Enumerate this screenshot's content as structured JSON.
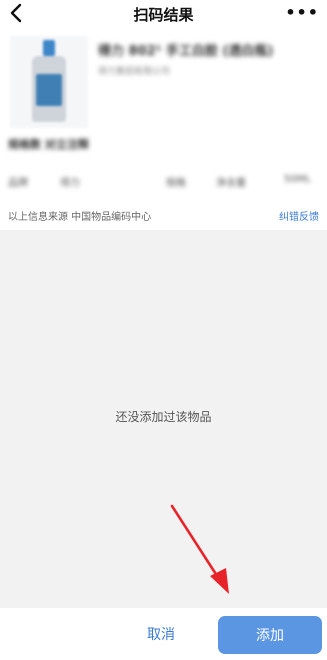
{
  "header": {
    "title": "扫码结果",
    "back_icon": "chevron-left-icon",
    "more_label": "•••"
  },
  "product": {
    "name": "得力 802¹ 手工白胶 (透白瓶)",
    "brand": "得力集团有限公司",
    "tag": "规格数 对立注释",
    "fields": [
      "品牌",
      "得力",
      "规格",
      "净含量",
      "50ML"
    ],
    "source_text": "以上信息来源 中国物品编码中心",
    "feedback_label": "纠错反馈"
  },
  "empty_state": {
    "message": "还没添加过该物品"
  },
  "actions": {
    "cancel_label": "取消",
    "add_label": "添加"
  },
  "colors": {
    "accent": "#3a7bd5",
    "add_button": "#5b96e3",
    "arrow": "#e8242b"
  }
}
